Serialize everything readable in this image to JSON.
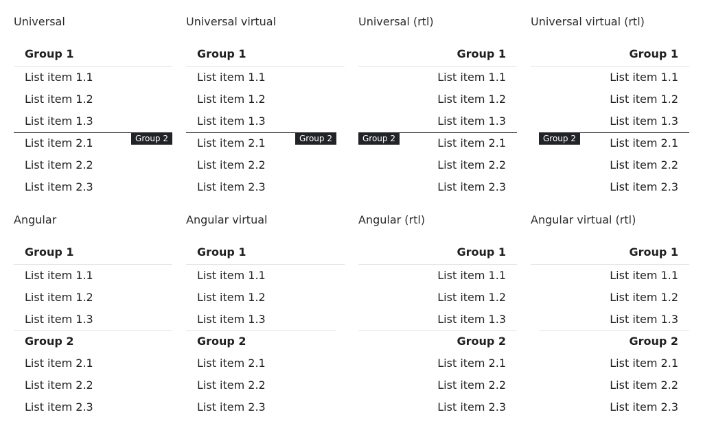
{
  "panels": [
    {
      "title": "Universal",
      "groups": [
        {
          "header": "Group 1",
          "items": [
            "List item 1.1",
            "List item 1.2",
            "List item 1.3"
          ]
        },
        {
          "header": "Group 2",
          "items": [
            "List item 2.1",
            "List item 2.2",
            "List item 2.3"
          ]
        }
      ]
    },
    {
      "title": "Universal virtual",
      "groups": [
        {
          "header": "Group 1",
          "items": [
            "List item 1.1",
            "List item 1.2",
            "List item 1.3"
          ]
        },
        {
          "header": "Group 2",
          "items": [
            "List item 2.1",
            "List item 2.2",
            "List item 2.3"
          ]
        }
      ]
    },
    {
      "title": "Universal (rtl)",
      "groups": [
        {
          "header": "Group 1",
          "items": [
            "List item 1.1",
            "List item 1.2",
            "List item 1.3"
          ]
        },
        {
          "header": "Group 2",
          "items": [
            "List item 2.1",
            "List item 2.2",
            "List item 2.3"
          ]
        }
      ]
    },
    {
      "title": "Universal virtual (rtl)",
      "groups": [
        {
          "header": "Group 1",
          "items": [
            "List item 1.1",
            "List item 1.2",
            "List item 1.3"
          ]
        },
        {
          "header": "Group 2",
          "items": [
            "List item 2.1",
            "List item 2.2",
            "List item 2.3"
          ]
        }
      ]
    },
    {
      "title": "Angular",
      "groups": [
        {
          "header": "Group 1",
          "items": [
            "List item 1.1",
            "List item 1.2",
            "List item 1.3"
          ]
        },
        {
          "header": "Group 2",
          "items": [
            "List item 2.1",
            "List item 2.2",
            "List item 2.3"
          ]
        }
      ]
    },
    {
      "title": "Angular virtual",
      "groups": [
        {
          "header": "Group 1",
          "items": [
            "List item 1.1",
            "List item 1.2",
            "List item 1.3"
          ]
        },
        {
          "header": "Group 2",
          "items": [
            "List item 2.1",
            "List item 2.2",
            "List item 2.3"
          ]
        }
      ]
    },
    {
      "title": "Angular (rtl)",
      "groups": [
        {
          "header": "Group 1",
          "items": [
            "List item 1.1",
            "List item 1.2",
            "List item 1.3"
          ]
        },
        {
          "header": "Group 2",
          "items": [
            "List item 2.1",
            "List item 2.2",
            "List item 2.3"
          ]
        }
      ]
    },
    {
      "title": "Angular virtual (rtl)",
      "groups": [
        {
          "header": "Group 1",
          "items": [
            "List item 1.1",
            "List item 1.2",
            "List item 1.3"
          ]
        },
        {
          "header": "Group 2",
          "items": [
            "List item 2.1",
            "List item 2.2",
            "List item 2.3"
          ]
        }
      ]
    }
  ]
}
